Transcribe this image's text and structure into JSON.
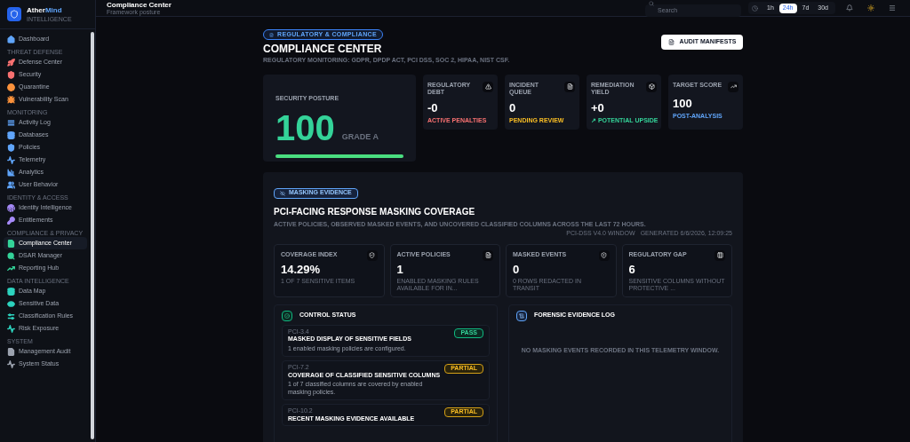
{
  "brand": {
    "name_a": "Ather",
    "name_b": "Mind",
    "tagline": "INTELLIGENCE"
  },
  "sidebar": {
    "sections": [
      {
        "items": [
          {
            "label": "Dashboard",
            "color": "#60a5fa",
            "selected": false
          }
        ]
      },
      {
        "heading": "THREAT DEFENSE",
        "items": [
          {
            "label": "Defense Center",
            "color": "#f87171",
            "selected": false
          },
          {
            "label": "Security",
            "color": "#f87171",
            "selected": false
          },
          {
            "label": "Quarantine",
            "color": "#fb923c",
            "selected": false
          },
          {
            "label": "Vulnerability Scan",
            "color": "#fb923c",
            "selected": false
          }
        ]
      },
      {
        "heading": "MONITORING",
        "items": [
          {
            "label": "Activity Log",
            "color": "#60a5fa",
            "selected": false
          },
          {
            "label": "Databases",
            "color": "#60a5fa",
            "selected": false
          },
          {
            "label": "Policies",
            "color": "#60a5fa",
            "selected": false
          },
          {
            "label": "Telemetry",
            "color": "#60a5fa",
            "selected": false
          },
          {
            "label": "Analytics",
            "color": "#60a5fa",
            "selected": false
          },
          {
            "label": "User Behavior",
            "color": "#60a5fa",
            "selected": false
          }
        ]
      },
      {
        "heading": "IDENTITY & ACCESS",
        "items": [
          {
            "label": "Identity Intelligence",
            "color": "#a78bfa",
            "selected": false
          },
          {
            "label": "Entitlements",
            "color": "#a78bfa",
            "selected": false
          }
        ]
      },
      {
        "heading": "COMPLIANCE & PRIVACY",
        "items": [
          {
            "label": "Compliance Center",
            "color": "#34d399",
            "selected": true
          },
          {
            "label": "DSAR Manager",
            "color": "#34d399",
            "selected": false
          },
          {
            "label": "Reporting Hub",
            "color": "#34d399",
            "selected": false
          }
        ]
      },
      {
        "heading": "DATA INTELLIGENCE",
        "items": [
          {
            "label": "Data Map",
            "color": "#2dd4bf",
            "selected": false
          },
          {
            "label": "Sensitive Data",
            "color": "#2dd4bf",
            "selected": false
          },
          {
            "label": "Classification Rules",
            "color": "#2dd4bf",
            "selected": false
          },
          {
            "label": "Risk Exposure",
            "color": "#2dd4bf",
            "selected": false
          }
        ]
      },
      {
        "heading": "SYSTEM",
        "items": [
          {
            "label": "Management Audit",
            "color": "#9ca3af",
            "selected": false
          },
          {
            "label": "System Status",
            "color": "#9ca3af",
            "selected": false
          }
        ]
      }
    ]
  },
  "header": {
    "title": "Compliance Center",
    "subtitle": "Framework posture",
    "search": {
      "placeholder": "Search"
    },
    "ranges": [
      {
        "label": "1h",
        "selected": false
      },
      {
        "label": "24h",
        "selected": true
      },
      {
        "label": "7d",
        "selected": false
      },
      {
        "label": "30d",
        "selected": false
      }
    ]
  },
  "page": {
    "badge": "REGULATORY & COMPLIANCE",
    "title": "COMPLIANCE CENTER",
    "subtitle": "REGULATORY MONITORING: GDPR, DPDP ACT, PCI DSS, SOC 2, HIPAA, NIST CSF.",
    "action": "AUDIT MANIFESTS"
  },
  "posture": {
    "label": "SECURITY POSTURE",
    "score": "100",
    "grade": "GRADE A",
    "level": 1.0
  },
  "kpis": [
    {
      "label": "REGULATORY DEBT",
      "value": "-0",
      "note": "ACTIVE PENALTIES",
      "color": "#f87171"
    },
    {
      "label": "INCIDENT QUEUE",
      "value": "0",
      "note": "PENDING REVIEW",
      "color": "#fbbf24"
    },
    {
      "label": "REMEDIATION YIELD",
      "value": "+0",
      "note": "↗ POTENTIAL UPSIDE",
      "color": "#34d399"
    },
    {
      "label": "TARGET SCORE",
      "value": "100",
      "note": "POST-ANALYSIS",
      "color": "#60a5fa"
    }
  ],
  "masking": {
    "badge": "MASKING EVIDENCE",
    "title": "PCI-FACING RESPONSE MASKING COVERAGE",
    "description": "ACTIVE POLICIES, OBSERVED MASKED EVENTS, AND UNCOVERED CLASSIFIED COLUMNS ACROSS THE LAST 72 HOURS.",
    "window": "PCI-DSS V4.0 WINDOW",
    "generated": "GENERATED 6/6/2026, 12:09:25",
    "stats": [
      {
        "label": "COVERAGE INDEX",
        "value": "14.29%",
        "note": "1 OF 7 SENSITIVE ITEMS"
      },
      {
        "label": "ACTIVE POLICIES",
        "value": "1",
        "note": "ENABLED MASKING RULES AVAILABLE FOR IN..."
      },
      {
        "label": "MASKED EVENTS",
        "value": "0",
        "note": "0 ROWS REDACTED IN TRANSIT"
      },
      {
        "label": "REGULATORY GAP",
        "value": "6",
        "note": "SENSITIVE COLUMNS WITHOUT PROTECTIVE ..."
      }
    ],
    "controls_title": "CONTROL STATUS",
    "controls": [
      {
        "id": "PCI-3.4",
        "title": "MASKED DISPLAY OF SENSITIVE FIELDS",
        "detail": "1 enabled masking policies are configured.",
        "status": "PASS",
        "kind": "pass"
      },
      {
        "id": "PCI-7.2",
        "title": "COVERAGE OF CLASSIFIED SENSITIVE COLUMNS",
        "detail": "1 of 7 classified columns are covered by enabled masking policies.",
        "status": "PARTIAL",
        "kind": "partial"
      },
      {
        "id": "PCI-10.2",
        "title": "RECENT MASKING EVIDENCE AVAILABLE",
        "status": "PARTIAL",
        "kind": "partial"
      }
    ],
    "log_title": "FORENSIC EVIDENCE LOG",
    "log_empty": "NO MASKING EVENTS RECORDED IN THIS TELEMETRY WINDOW."
  }
}
